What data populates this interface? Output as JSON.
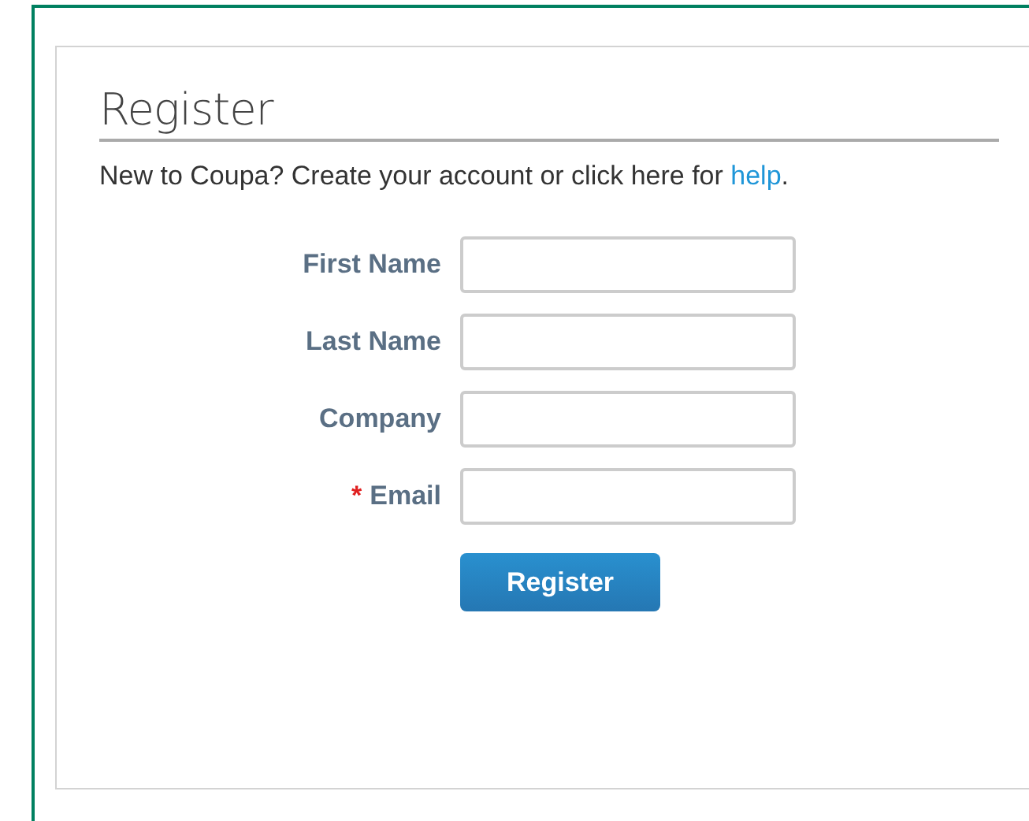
{
  "heading": "Register",
  "intro": {
    "text": "New to Coupa? Create your account or click here for ",
    "link": "help",
    "after": "."
  },
  "fields": [
    {
      "label": "First Name"
    },
    {
      "label": "Last Name"
    },
    {
      "label": "Company"
    },
    {
      "label": "Email",
      "marker": "*"
    }
  ],
  "submit": "Register"
}
